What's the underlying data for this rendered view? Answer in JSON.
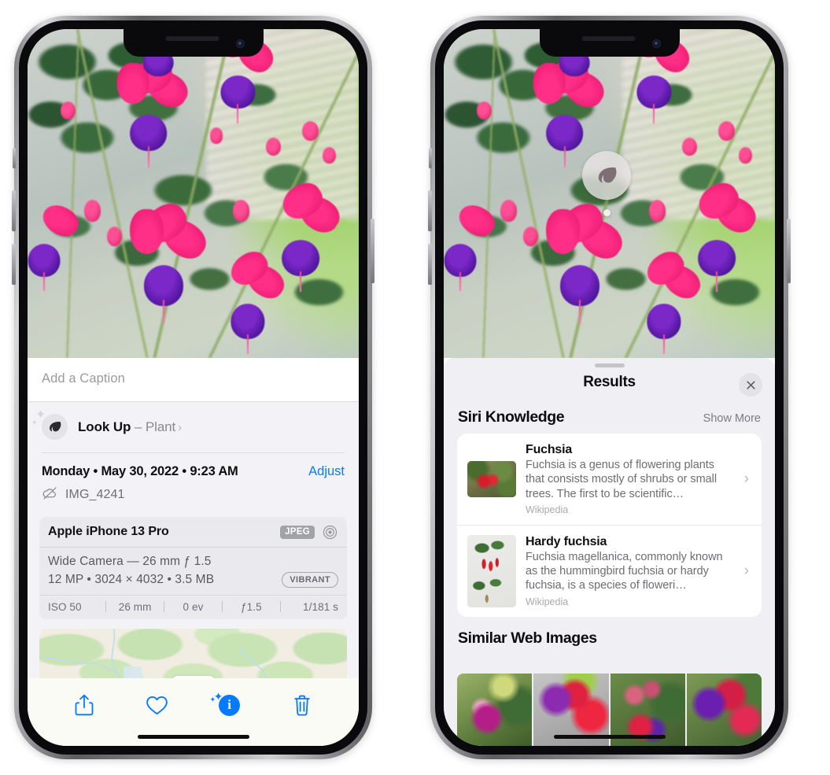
{
  "left_phone": {
    "photo": {
      "alt_name": "fuchsia-flowers-photo"
    },
    "caption": {
      "placeholder": "Add a Caption",
      "value": ""
    },
    "look_up": {
      "icon": "leaf-icon",
      "title": "Look Up",
      "separator": " – ",
      "subject": "Plant",
      "chevron": "›"
    },
    "meta": {
      "datetime": "Monday • May 30, 2022 • 9:23 AM",
      "adjust_label": "Adjust",
      "cloud_icon": "cloud-slash-icon",
      "filename": "IMG_4241"
    },
    "exif": {
      "device": "Apple iPhone 13 Pro",
      "format_badge": "JPEG",
      "lens_icon": "aperture-icon",
      "lens_line": "Wide Camera — 26 mm ƒ 1.5",
      "specs_line": "12 MP • 3024 × 4032 • 3.5 MB",
      "style_badge": "VIBRANT",
      "stats": [
        "ISO 50",
        "26 mm",
        "0 ev",
        "ƒ1.5",
        "1/181 s"
      ]
    },
    "map": {
      "name": "location-map-thumbnail"
    },
    "toolbar": {
      "share_label": "share-icon",
      "favorite_label": "heart-icon",
      "info_label": "info-icon",
      "delete_label": "trash-icon"
    }
  },
  "right_phone": {
    "photo": {
      "alt_name": "fuchsia-flowers-photo"
    },
    "visual_lookup_badge": {
      "icon": "leaf-icon"
    },
    "sheet": {
      "title": "Results",
      "close_icon": "close-icon",
      "sections": [
        {
          "title": "Siri Knowledge",
          "action": "Show More",
          "items": [
            {
              "title": "Fuchsia",
              "description": "Fuchsia is a genus of flowering plants that consists mostly of shrubs or small trees. The first to be scientific…",
              "source": "Wikipedia",
              "chevron": "›"
            },
            {
              "title": "Hardy fuchsia",
              "description": "Fuchsia magellanica, commonly known as the hummingbird fuchsia or hardy fuchsia, is a species of floweri…",
              "source": "Wikipedia",
              "chevron": "›"
            }
          ]
        },
        {
          "title": "Similar Web Images",
          "action": "",
          "thumbnails": [
            "web-image-1",
            "web-image-2",
            "web-image-3",
            "web-image-4"
          ]
        }
      ]
    }
  },
  "colors": {
    "accent_blue": "#067aff",
    "sheet_bg": "#efeff4",
    "info_bg": "#f2f2f7",
    "card_bg": "#ffffff",
    "badge_gray": "#a2a2a9"
  }
}
